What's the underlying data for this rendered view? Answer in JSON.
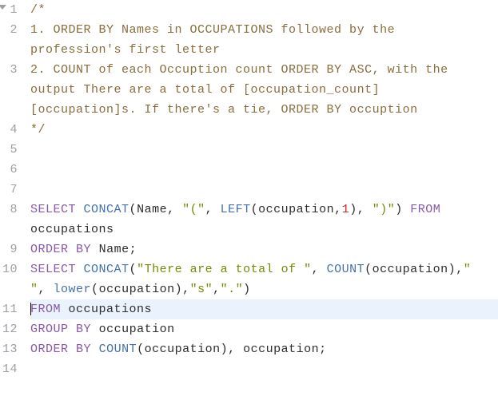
{
  "gutter": {
    "l1": "1",
    "l2": "2",
    "l3": "3",
    "l4": "4",
    "l5": "5",
    "l6": "6",
    "l7": "7",
    "l8": "8",
    "l9": "9",
    "l10": "10",
    "l11": "11",
    "l12": "12",
    "l13": "13",
    "l14": "14"
  },
  "code": {
    "l1": {
      "comment": "/*"
    },
    "l2": {
      "comment": "1. ORDER BY Names in OCCUPATIONS followed by the profession's first letter"
    },
    "l3": {
      "comment": "2. COUNT of each Occuption count ORDER BY ASC, with the output There are a total of [occupation_count] [occupation]s. If there's a tie, ORDER BY occuption"
    },
    "l4": {
      "comment": "*/"
    },
    "l5": {
      "text": ""
    },
    "l6": {
      "text": ""
    },
    "l7": {
      "text": ""
    },
    "l8": {
      "kw_select": "SELECT",
      "sp1": " ",
      "fn_concat": "CONCAT",
      "p1": "(",
      "id_name": "Name",
      "c1": ", ",
      "s_open": "\"(\"",
      "c2": ", ",
      "fn_left": "LEFT",
      "p2": "(",
      "id_occ": "occupation",
      "c3": ",",
      "num1": "1",
      "p3": ")",
      "c4": ", ",
      "s_close": "\")\"",
      "p4": ")",
      "sp2": " ",
      "kw_from": "FROM",
      "sp3": " ",
      "id_table": "occupations"
    },
    "l9": {
      "kw_order": "ORDER",
      "sp1": " ",
      "kw_by": "BY",
      "sp2": " ",
      "id_name": "Name",
      "semi": ";"
    },
    "l10": {
      "kw_select": "SELECT",
      "sp1": " ",
      "fn_concat": "CONCAT",
      "p1": "(",
      "s_there": "\"There are a total of \"",
      "c1": ", ",
      "fn_count": "COUNT",
      "p2": "(",
      "id_occ1": "occupation",
      "p3": ")",
      "c2": ",",
      "s_sp": "\" \"",
      "c3": ", ",
      "fn_lower": "lower",
      "p4": "(",
      "id_occ2": "occupation",
      "p5": ")",
      "c4": ",",
      "s_s": "\"s\"",
      "c5": ",",
      "s_dot": "\".\"",
      "p6": ")"
    },
    "l11": {
      "kw_from": "FROM",
      "sp1": " ",
      "id_table": "occupations"
    },
    "l12": {
      "kw_group": "GROUP",
      "sp1": " ",
      "kw_by": "BY",
      "sp2": " ",
      "id_occ": "occupation"
    },
    "l13": {
      "kw_order": "ORDER",
      "sp1": " ",
      "kw_by": "BY",
      "sp2": " ",
      "fn_count": "COUNT",
      "p1": "(",
      "id_occ1": "occupation",
      "p2": ")",
      "c1": ", ",
      "id_occ2": "occupation",
      "semi": ";"
    },
    "l14": {
      "text": ""
    }
  }
}
